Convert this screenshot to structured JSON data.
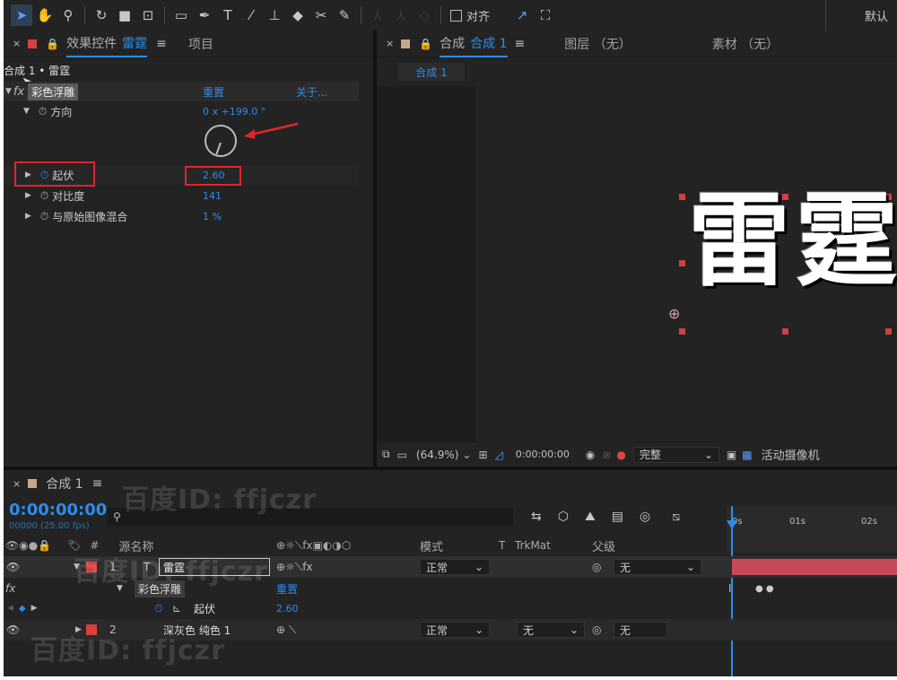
{
  "top_toolbar": {
    "align_label": "对齐",
    "workspace_label": "默认",
    "tools": [
      "selection-icon",
      "hand-icon",
      "zoom-icon",
      "rotate-icon",
      "camera-icon",
      "anchor-icon",
      "rectangle-icon",
      "pen-icon",
      "text-icon",
      "brush-icon",
      "stamp-icon",
      "eraser-icon",
      "roto-icon",
      "pin-icon"
    ]
  },
  "effects_panel": {
    "tab_label": "效果控件",
    "tab_layer": "雷霆",
    "tab_menu": "≡",
    "project_tab": "项目",
    "breadcrumb": "合成 1 • 雷霆",
    "effect_name": "彩色浮雕",
    "reset_label": "重置",
    "about_label": "关于...",
    "props": [
      {
        "name": "方向",
        "value": "0 x +199.0 °"
      },
      {
        "name": "起伏",
        "value": "2.60"
      },
      {
        "name": "对比度",
        "value": "141"
      },
      {
        "name": "与原始图像混合",
        "value": "1 %"
      }
    ]
  },
  "comp_panel": {
    "tab_prefix": "合成",
    "tab_name": "合成 1",
    "tab_menu": "≡",
    "layer_tab": "图层 （无）",
    "footage_tab": "素材 （无）",
    "comp_chip": "合成 1",
    "canvas_text": "雷霆",
    "zoom": "(64.9%)",
    "timecode": "0:00:00:00",
    "quality": "完整",
    "camera": "活动摄像机"
  },
  "timeline": {
    "tab_label": "合成 1",
    "tab_menu": "≡",
    "timecode": "0:00:00:00",
    "frame_info": "00000 (25.00 fps)",
    "search_placeholder": "",
    "ruler": [
      "0s",
      "01s",
      "02s"
    ],
    "columns": {
      "hash": "#",
      "source_name": "源名称",
      "mode": "模式",
      "t": "T",
      "trkmat": "TrkMat",
      "parent": "父级"
    },
    "layers": [
      {
        "num": "1",
        "name": "雷霆",
        "mode": "正常",
        "parent": "无"
      },
      {
        "num": "2",
        "name": "深灰色 纯色 1",
        "mode": "正常",
        "trkmat": "无",
        "parent": "无"
      }
    ],
    "effect_row": {
      "name": "彩色浮雕",
      "reset": "重置"
    },
    "prop_row": {
      "name": "起伏",
      "value": "2.60"
    },
    "fx_label": "fx"
  },
  "watermarks": [
    "百度ID: ffjczr",
    "百度ID: ffjczr",
    "百度ID: ffjczr"
  ]
}
